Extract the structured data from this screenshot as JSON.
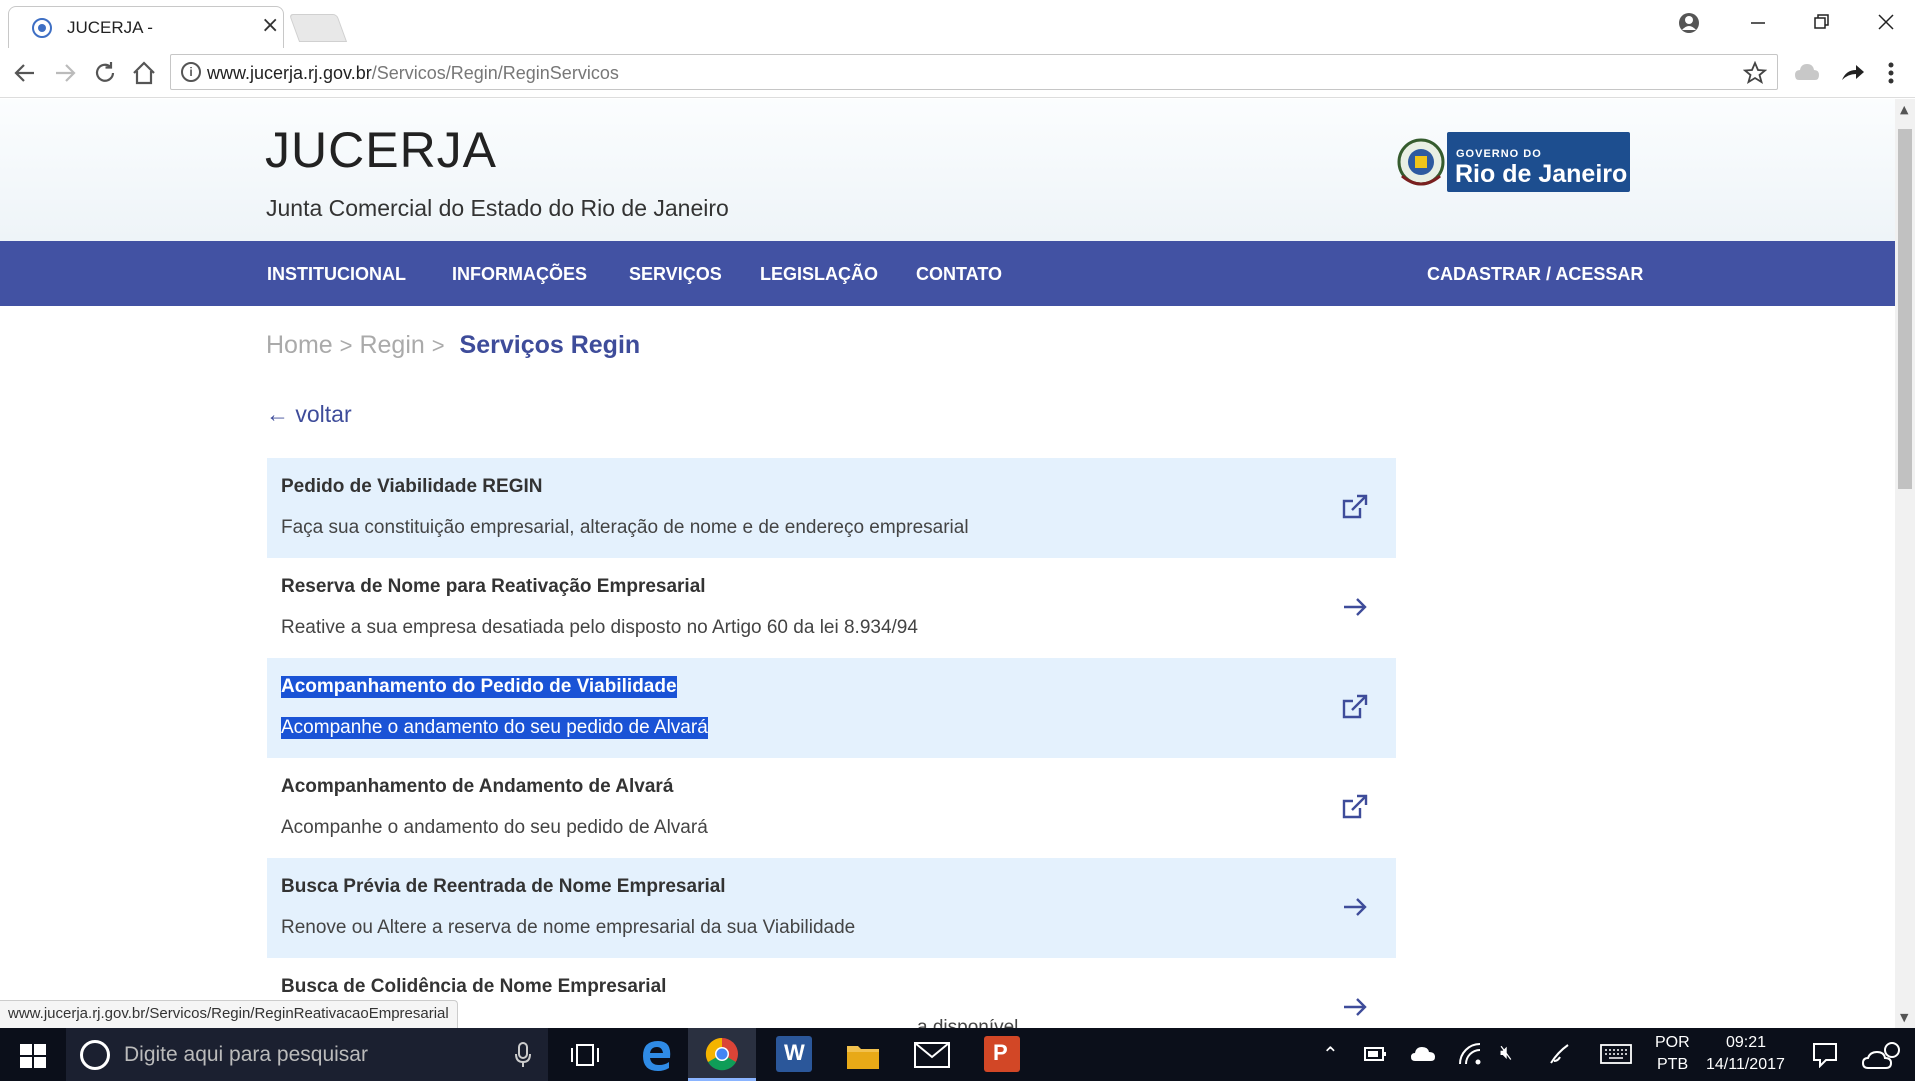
{
  "browser": {
    "tab_title": "JUCERJA -",
    "tab_close": "×",
    "url_domain": "www.jucerja.rj.gov.br",
    "url_path": "/Servicos/Regin/ReginServicos",
    "status_url": "www.jucerja.rj.gov.br/Servicos/Regin/ReginReativacaoEmpresarial"
  },
  "header": {
    "title": "JUCERJA",
    "subtitle": "Junta Comercial do Estado do Rio de Janeiro",
    "gov_small": "GOVERNO DO",
    "gov_big": "Rio de Janeiro"
  },
  "nav": {
    "items": [
      "INSTITUCIONAL",
      "INFORMAÇÕES",
      "SERVIÇOS",
      "LEGISLAÇÃO",
      "CONTATO"
    ],
    "account": "CADASTRAR / ACESSAR"
  },
  "breadcrumb": {
    "home": "Home",
    "regin": "Regin",
    "sep": ">",
    "current": "Serviços Regin"
  },
  "back_label": "← voltar",
  "services": [
    {
      "title": "Pedido de Viabilidade REGIN",
      "desc": "Faça sua constituição empresarial, alteração de nome e de endereço empresarial",
      "icon": "external-link-icon"
    },
    {
      "title": "Reserva de Nome para Reativação Empresarial",
      "desc": "Reative a sua empresa desatiada pelo disposto no Artigo 60 da lei 8.934/94",
      "icon": "arrow-right-icon"
    },
    {
      "title": "Acompanhamento do Pedido de Viabilidade",
      "desc": "Acompanhe o andamento do seu pedido de Alvará",
      "icon": "external-link-icon"
    },
    {
      "title": "Acompanhamento de Andamento de Alvará",
      "desc": "Acompanhe o andamento do seu pedido de Alvará",
      "icon": "external-link-icon"
    },
    {
      "title": "Busca Prévia de Reentrada de Nome Empresarial",
      "desc": "Renove ou Altere a reserva de nome empresarial da sua Viabilidade",
      "icon": "arrow-right-icon"
    },
    {
      "title": "Busca de Colidência de Nome Empresarial",
      "desc": "a disponível",
      "icon": "arrow-right-icon"
    }
  ],
  "taskbar": {
    "search_placeholder": "Digite aqui para pesquisar",
    "lang_top": "POR",
    "lang_bottom": "PTB",
    "time": "09:21",
    "date": "14/11/2017"
  },
  "colors": {
    "nav_bg": "#4252a3",
    "accent": "#3e4c9a",
    "row_shade": "#e4f1fd",
    "selection": "#1a53d6"
  }
}
